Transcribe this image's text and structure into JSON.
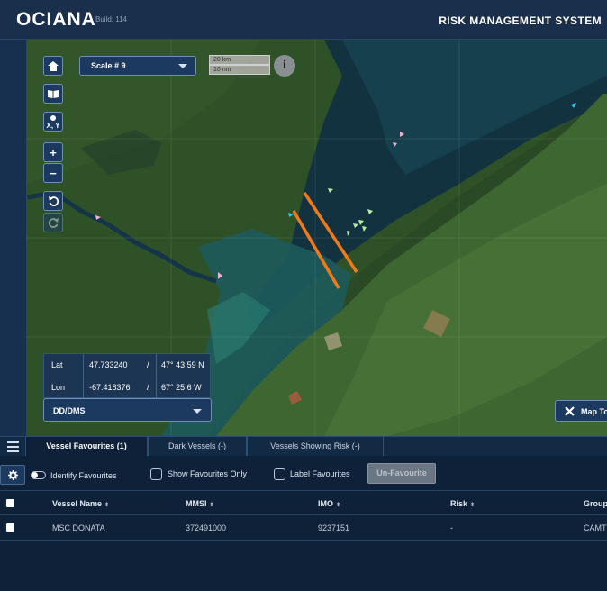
{
  "header": {
    "logo_text": "OCIANA",
    "build_label": "Build: 114",
    "title": "RISK MANAGEMENT SYSTEM"
  },
  "map": {
    "scale_select": {
      "value": "Scale # 9"
    },
    "scale_bar": {
      "km_label": "20 km",
      "nm_label": "10 nm"
    },
    "info_label": "i",
    "xy_label": "X, Y",
    "zoom_in_label": "+",
    "zoom_out_label": "−",
    "coords": {
      "lat_label": "Lat",
      "lat_decimal": "47.733240",
      "lat_dms": "47° 43 59 N",
      "lon_label": "Lon",
      "lon_decimal": "-67.418376",
      "lon_dms": "67° 25 6 W",
      "separator": "/"
    },
    "format_select": {
      "value": "DD/DMS"
    },
    "map_tools_label": "Map To",
    "colors": {
      "water": "#173a45",
      "land": "#2b4f29",
      "line": "#f07a18",
      "vessel_green": "#b7f0a0",
      "vessel_pink": "#f3b0d0",
      "vessel_cyan": "#27c7e8"
    }
  },
  "tabs": [
    {
      "label": "Vessel Favourites (1)",
      "active": true
    },
    {
      "label": "Dark Vessels (-)",
      "active": false
    },
    {
      "label": "Vessels Showing Risk (-)",
      "active": false
    }
  ],
  "panel": {
    "identify_label": "Identify Favourites",
    "show_only_label": "Show Favourites Only",
    "label_fav_label": "Label Favourites",
    "unfav_label": "Un-Favourite"
  },
  "table": {
    "columns": [
      "Vessel Name",
      "MMSI",
      "IMO",
      "Risk",
      "Group"
    ],
    "sort_glyph": "⬍",
    "rows": [
      {
        "vessel_name": "MSC DONATA",
        "mmsi": "372491000",
        "imo": "9237151",
        "risk": "-",
        "group": "CAMT"
      }
    ]
  }
}
